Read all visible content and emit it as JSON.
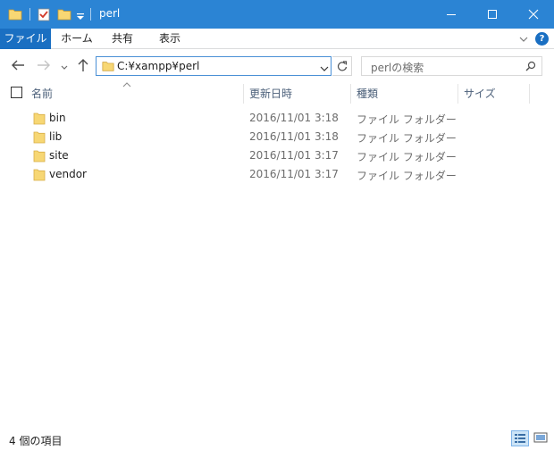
{
  "window": {
    "title": "perl",
    "icons": [
      "folder-icon",
      "properties-icon",
      "new-folder-icon",
      "customize-quick-access-icon"
    ],
    "controls": [
      "minimize-icon",
      "maximize-icon",
      "close-icon"
    ],
    "title_bar_color": "#2b84d4"
  },
  "ribbon": {
    "tabs": [
      {
        "label": "ファイル",
        "active": true
      },
      {
        "label": "ホーム"
      },
      {
        "label": "共有"
      },
      {
        "label": "表示"
      }
    ],
    "accent": "#1a6fc2",
    "help_label": "?"
  },
  "nav": {
    "address": "C:¥xampp¥perl",
    "search_placeholder": "perlの検索"
  },
  "columns": [
    "名前",
    "更新日時",
    "種類",
    "サイズ"
  ],
  "items": [
    {
      "name": "bin",
      "date": "2016/11/01 3:18",
      "type": "ファイル フォルダー"
    },
    {
      "name": "lib",
      "date": "2016/11/01 3:18",
      "type": "ファイル フォルダー"
    },
    {
      "name": "site",
      "date": "2016/11/01 3:17",
      "type": "ファイル フォルダー"
    },
    {
      "name": "vendor",
      "date": "2016/11/01 3:17",
      "type": "ファイル フォルダー"
    }
  ],
  "status": {
    "item_count": "4 個の項目"
  }
}
